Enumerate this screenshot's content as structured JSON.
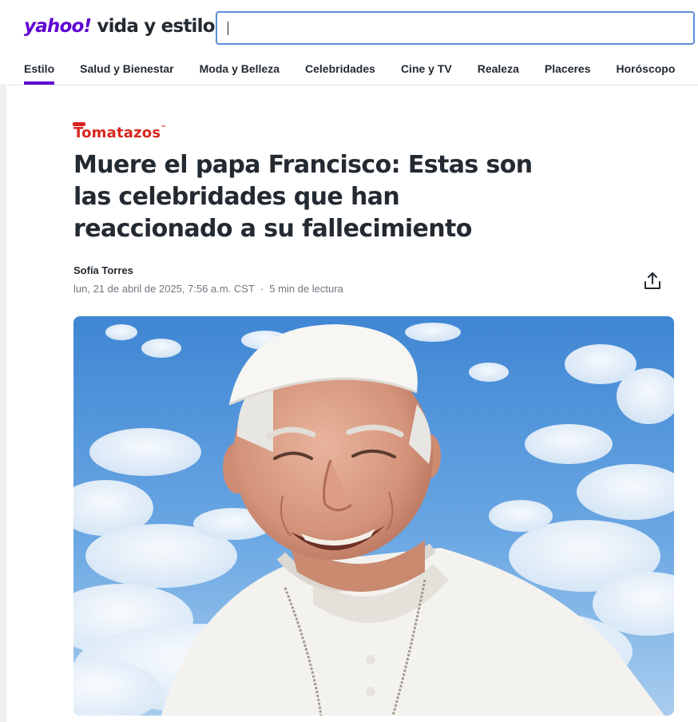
{
  "header": {
    "brand": "yahoo!",
    "section": "vida y estilo",
    "search": {
      "value": "",
      "placeholder": ""
    }
  },
  "nav": {
    "items": [
      {
        "label": "Estilo",
        "active": true
      },
      {
        "label": "Salud y Bienestar",
        "active": false
      },
      {
        "label": "Moda y Belleza",
        "active": false
      },
      {
        "label": "Celebridades",
        "active": false
      },
      {
        "label": "Cine y TV",
        "active": false
      },
      {
        "label": "Realeza",
        "active": false
      },
      {
        "label": "Placeres",
        "active": false
      },
      {
        "label": "Horóscopo",
        "active": false
      }
    ]
  },
  "article": {
    "source": "Tomatazos",
    "title": "Muere el papa Francisco: Estas son las celebridades que han reaccionado a su fallecimiento",
    "author": "Sofía Torres",
    "date": "lun, 21 de abril de 2025, 7:56 a.m. CST",
    "read_time": "5  min de lectura",
    "share_icon": "share-icon",
    "hero_image": "photo-pope-francis-smiling-sky-clouds"
  },
  "colors": {
    "brand_purple": "#6001d2",
    "text_primary": "#232a31",
    "text_secondary": "#6e7780",
    "source_red": "#d6261e",
    "search_border": "#5b8fd7",
    "sky_blue": "#4a8fd6"
  }
}
